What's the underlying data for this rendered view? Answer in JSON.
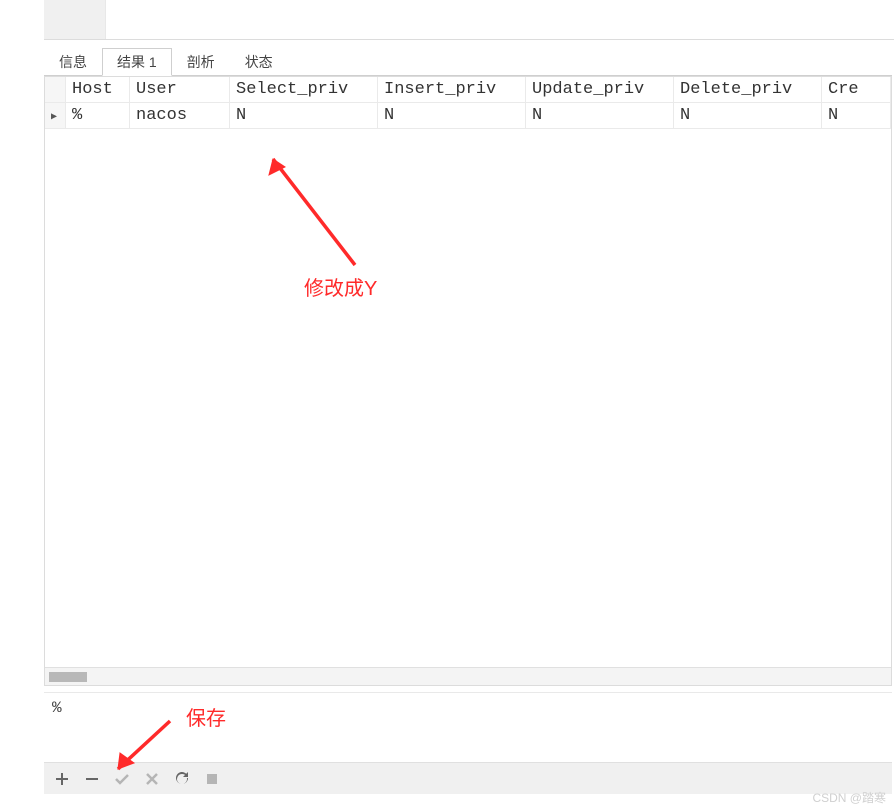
{
  "tabs": {
    "info": "信息",
    "result": "结果 1",
    "profile": "剖析",
    "status": "状态",
    "active": "result"
  },
  "grid": {
    "columns": [
      "Host",
      "User",
      "Select_priv",
      "Insert_priv",
      "Update_priv",
      "Delete_priv",
      "Cre"
    ],
    "rows": [
      {
        "host": "%",
        "user": "nacos",
        "select_priv": "N",
        "insert_priv": "N",
        "update_priv": "N",
        "delete_priv": "N",
        "create_priv": "N"
      }
    ]
  },
  "info_row": {
    "text": "%"
  },
  "toolbar": {
    "add": "+",
    "remove": "−",
    "apply": "✔",
    "cancel": "✖",
    "refresh": "⟳",
    "stop": "■"
  },
  "annotations": {
    "modify_label": "修改成Y",
    "save_label": "保存"
  },
  "watermark": "CSDN @踏寒"
}
